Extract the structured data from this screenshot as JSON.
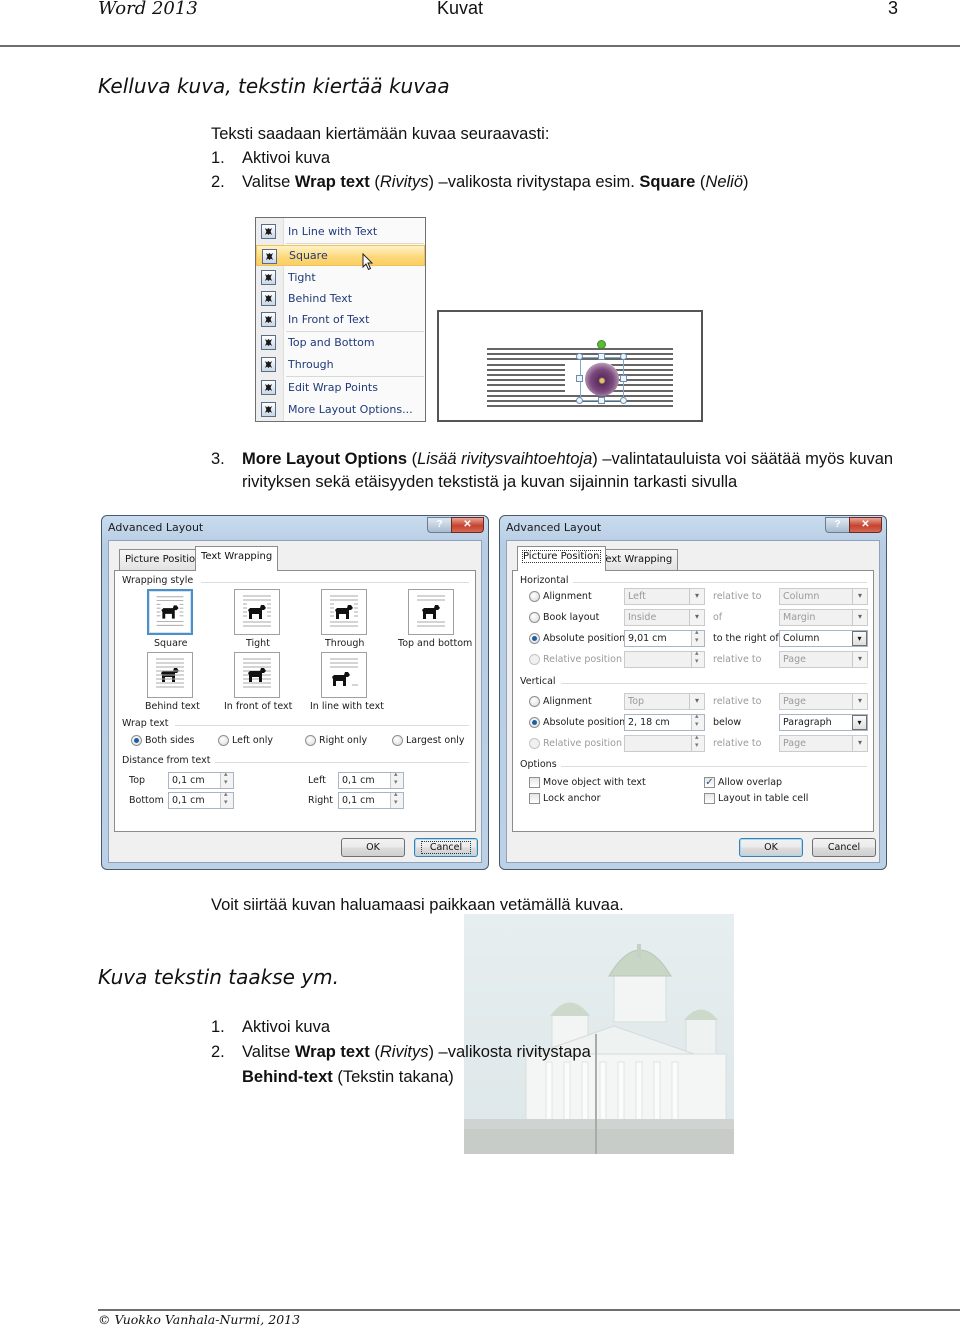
{
  "header": {
    "left": "Word 2013",
    "center": "Kuvat",
    "page_number": "3"
  },
  "section1": {
    "title": "Kelluva kuva, tekstin kiertää kuvaa",
    "intro": "Teksti saadaan kiertämään kuvaa  seuraavasti:",
    "steps": [
      {
        "num": "1.",
        "text": "Aktivoi kuva"
      },
      {
        "num": "2.",
        "pre": "Valitse ",
        "bold1": "Wrap text",
        "mid1": " (",
        "italic1": "Rivitys",
        "mid2": ") –valikosta  rivitystapa esim. ",
        "bold2": "Square",
        "mid3": " (",
        "italic2": "Neliö",
        "end": ")"
      },
      {
        "num": "3.",
        "bold1": "More Layout Options",
        "mid1": " (",
        "italic1": "Lisää rivitysvaihtoehtoja",
        "end": ") –valintatauluista voi säätää myös kuvan",
        "line2": "rivityksen sekä etäisyyden tekstistä ja kuvan sijainnin tarkasti sivulla"
      }
    ]
  },
  "wrap_menu": {
    "items": [
      {
        "label": "In Line with Text",
        "highlighted": false
      },
      {
        "label": "Square",
        "highlighted": true
      },
      {
        "label": "Tight",
        "highlighted": false
      },
      {
        "label": "Behind Text",
        "highlighted": false
      },
      {
        "label": "In Front of Text",
        "highlighted": false
      },
      {
        "label": "Top and Bottom",
        "highlighted": false
      },
      {
        "label": "Through",
        "highlighted": false
      },
      {
        "label": "Edit Wrap Points",
        "highlighted": false
      },
      {
        "label": "More Layout Options...",
        "highlighted": false
      }
    ]
  },
  "dialog_wrapping": {
    "title": "Advanced Layout",
    "help_icon": "?",
    "close_icon": "✕",
    "tabs": [
      {
        "label": "Picture Position",
        "active": false
      },
      {
        "label": "Text Wrapping",
        "active": true
      }
    ],
    "wrapping_style_label": "Wrapping style",
    "styles": [
      {
        "label": "Square",
        "selected": true
      },
      {
        "label": "Tight",
        "selected": false
      },
      {
        "label": "Through",
        "selected": false
      },
      {
        "label": "Top and bottom",
        "selected": false
      },
      {
        "label": "Behind text",
        "selected": false
      },
      {
        "label": "In front of text",
        "selected": false
      },
      {
        "label": "In line with text",
        "selected": false
      }
    ],
    "wrap_text_label": "Wrap text",
    "wrap_options": [
      {
        "label": "Both sides",
        "checked": true
      },
      {
        "label": "Left only",
        "checked": false
      },
      {
        "label": "Right only",
        "checked": false
      },
      {
        "label": "Largest only",
        "checked": false
      }
    ],
    "distance_label": "Distance from text",
    "distances": {
      "top": {
        "label": "Top",
        "value": "0,1 cm"
      },
      "bottom": {
        "label": "Bottom",
        "value": "0,1 cm"
      },
      "left": {
        "label": "Left",
        "value": "0,1 cm"
      },
      "right": {
        "label": "Right",
        "value": "0,1 cm"
      }
    },
    "ok_label": "OK",
    "cancel_label": "Cancel"
  },
  "dialog_position": {
    "title": "Advanced Layout",
    "help_icon": "?",
    "close_icon": "✕",
    "tabs": [
      {
        "label": "Picture Position",
        "active": true
      },
      {
        "label": "Text Wrapping",
        "active": false
      }
    ],
    "horizontal_label": "Horizontal",
    "horizontal": [
      {
        "label": "Alignment",
        "checked": false,
        "disabled": false,
        "value": "Left",
        "rel_label": "relative to",
        "rel_value": "Column"
      },
      {
        "label": "Book layout",
        "checked": false,
        "disabled": false,
        "value": "Inside",
        "rel_label": "of",
        "rel_value": "Margin"
      },
      {
        "label": "Absolute position",
        "checked": true,
        "disabled": false,
        "value": "9,01 cm",
        "rel_label": "to the right of",
        "rel_value": "Column"
      },
      {
        "label": "Relative position",
        "checked": false,
        "disabled": true,
        "value": "",
        "rel_label": "relative to",
        "rel_value": "Page"
      }
    ],
    "vertical_label": "Vertical",
    "vertical": [
      {
        "label": "Alignment",
        "checked": false,
        "disabled": false,
        "value": "Top",
        "rel_label": "relative to",
        "rel_value": "Page"
      },
      {
        "label": "Absolute position",
        "checked": true,
        "disabled": false,
        "value": "2, 18 cm",
        "rel_label": "below",
        "rel_value": "Paragraph"
      },
      {
        "label": "Relative position",
        "checked": false,
        "disabled": true,
        "value": "",
        "rel_label": "relative to",
        "rel_value": "Page"
      }
    ],
    "options_label": "Options",
    "options": [
      {
        "label": "Move object with text",
        "checked": false
      },
      {
        "label": "Lock anchor",
        "checked": false
      },
      {
        "label": "Allow overlap",
        "checked": true
      },
      {
        "label": "Layout in table cell",
        "checked": false
      }
    ],
    "ok_label": "OK",
    "cancel_label": "Cancel"
  },
  "move_text": "Voit siirtää kuvan haluamaasi paikkaan vetämällä kuvaa.",
  "section2": {
    "title": "Kuva tekstin taakse ym.",
    "steps": [
      {
        "num": "1.",
        "text": "Aktivoi kuva"
      },
      {
        "num": "2.",
        "pre": "Valitse ",
        "bold1": "Wrap text",
        "mid1": "  (",
        "italic1": "Rivitys",
        "mid2": ") –valikosta  rivitystapa",
        "bold2": "Behind-text",
        "end": " (Tekstin takana)"
      }
    ]
  },
  "footer": {
    "text": "© Vuokko Vanhala-Nurmi, 2013"
  }
}
